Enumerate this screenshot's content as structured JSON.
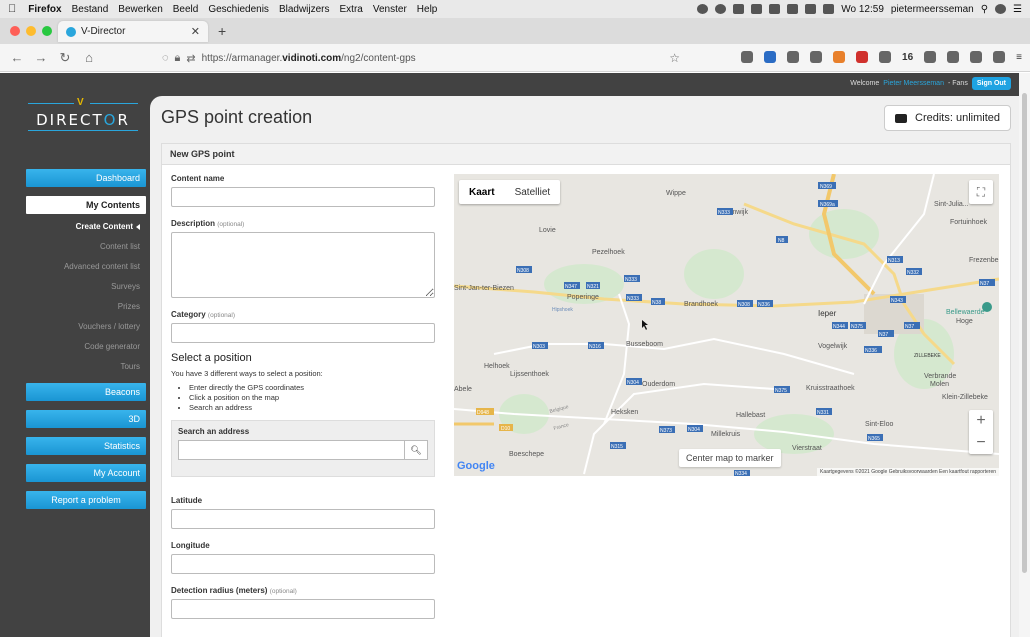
{
  "menubar": {
    "app": "Firefox",
    "items": [
      "Bestand",
      "Bewerken",
      "Beeld",
      "Geschiedenis",
      "Bladwijzers",
      "Extra",
      "Venster",
      "Help"
    ],
    "clock": "Wo 12:59",
    "user": "pietermeersseman"
  },
  "browser": {
    "tab_title": "V-Director",
    "url_prefix": "https://armanager.",
    "url_host": "vidinoti.com",
    "url_path": "/ng2/content-gps",
    "badge_count": "16"
  },
  "page": {
    "welcome": "Welcome",
    "welcome_user": "Pieter Meersseman",
    "welcome_suffix": "- Fans",
    "sign_out": "Sign Out",
    "logo": {
      "v": "V",
      "text_1": "DIRECT",
      "text_o": "O",
      "text_2": "R"
    },
    "title": "GPS point creation",
    "credits": "Credits: unlimited"
  },
  "sidebar": {
    "dashboard": "Dashboard",
    "my_contents": "My Contents",
    "sub": [
      "Create Content",
      "Content list",
      "Advanced content list",
      "Surveys",
      "Prizes",
      "Vouchers / lottery",
      "Code generator",
      "Tours"
    ],
    "beacons": "Beacons",
    "three_d": "3D",
    "statistics": "Statistics",
    "my_account": "My Account",
    "report": "Report a problem"
  },
  "form": {
    "panel_title": "New GPS point",
    "content_name": "Content name",
    "description": "Description",
    "optional": "(optional)",
    "category": "Category",
    "select_heading": "Select a position",
    "select_intro": "You have 3 different ways to select a position:",
    "ways": [
      "Enter directly the GPS coordinates",
      "Click a position on the map",
      "Search an address"
    ],
    "search_address": "Search an address",
    "latitude": "Latitude",
    "longitude": "Longitude",
    "radius": "Detection radius (meters)"
  },
  "map": {
    "type_map": "Kaart",
    "type_sat": "Satelliet",
    "center_btn": "Center map to marker",
    "google": "Google",
    "attribution": "Kaartgegevens ©2021 Google   Gebruiksvoorwaarden   Een kaartfout rapporteren",
    "places": [
      "Wippe",
      "Tuimwijk",
      "Lovie",
      "Pezelhoek",
      "Poperinge",
      "Hipshoek",
      "Brandhoek",
      "Ieper",
      "Busseboom",
      "Vogelwijk",
      "Sint-Jan-ter-Biezen",
      "Helhoek",
      "Lijssenthoek",
      "Abele",
      "Ouderdom",
      "Kruisstraathoek",
      "Heksken",
      "Hallebast",
      "Millekruis",
      "Vierstraat",
      "Boeschepe",
      "Sint-Eloo",
      "Verbrande Molen",
      "Klein-Zillebeke",
      "Fortuinhoek",
      "Frezenberg",
      "Bellewaerde",
      "Hooge",
      "Sint-Julia...",
      "Zillebeke"
    ],
    "roads": [
      "N333",
      "N8",
      "N38",
      "N308",
      "N321",
      "N336",
      "N304",
      "N373",
      "N375",
      "N315",
      "N331",
      "N365",
      "N343",
      "N37",
      "N313",
      "N332",
      "N369",
      "N369a",
      "D948",
      "D10",
      "N316",
      "N303",
      "N324",
      "N344",
      "N334"
    ]
  }
}
